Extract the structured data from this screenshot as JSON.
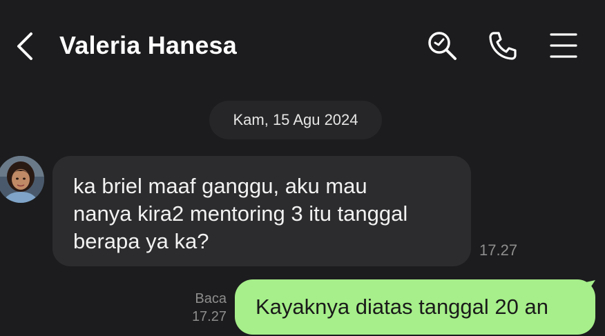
{
  "header": {
    "contact_name": "Valeria Hanesa",
    "back_icon": "chevron-left-icon",
    "search_icon": "search-icon",
    "call_icon": "phone-icon",
    "menu_icon": "menu-icon"
  },
  "conversation": {
    "date_label": "Kam, 15 Agu 2024",
    "messages": [
      {
        "direction": "incoming",
        "text": "ka briel maaf ganggu, aku mau\nnanya kira2 mentoring 3 itu tanggal\nberapa ya ka?",
        "time": "17.27"
      },
      {
        "direction": "outgoing",
        "text": "Kayaknya diatas tanggal 20 an",
        "status": "Baca",
        "time": "17.27"
      }
    ]
  },
  "colors": {
    "background": "#1c1c1e",
    "incoming_bubble": "#2c2c2e",
    "outgoing_bubble": "#a6ef8a",
    "meta_text": "#8e8e8e"
  }
}
